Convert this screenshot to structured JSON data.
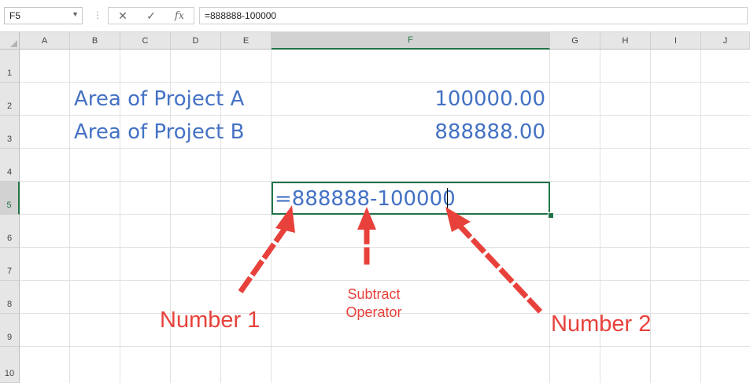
{
  "formula_bar": {
    "name_box": "F5",
    "cancel_icon": "✕",
    "enter_icon": "✓",
    "function_icon": "fx",
    "formula": "=888888-100000"
  },
  "columns": [
    "A",
    "B",
    "C",
    "D",
    "E",
    "F",
    "G",
    "H",
    "I",
    "J"
  ],
  "active_column": "F",
  "rows": [
    "1",
    "2",
    "3",
    "4",
    "5",
    "6",
    "7",
    "8",
    "9",
    "10"
  ],
  "active_row": "5",
  "cells": {
    "B2": "Area of Project A",
    "F2": "100000.00",
    "B3": "Area of Project B",
    "F3": "888888.00",
    "F5": "=888888-100000"
  },
  "annotations": {
    "number1": "Number 1",
    "operator_line1": "Subtract",
    "operator_line2": "Operator",
    "number2": "Number 2"
  },
  "colors": {
    "accent_green": "#217346",
    "cell_text_blue": "#4472c4",
    "annotation_red": "#e8413b"
  }
}
